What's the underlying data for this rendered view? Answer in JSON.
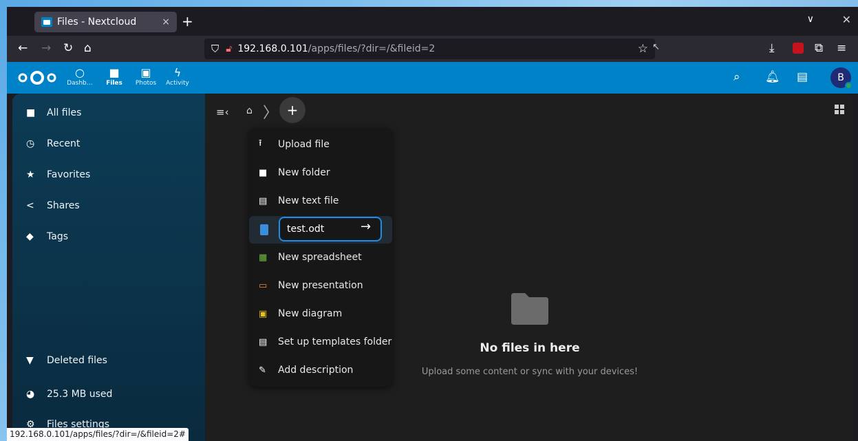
{
  "browser": {
    "tab_title": "Files - Nextcloud",
    "tab_close": "×",
    "new_tab": "+",
    "tab_list": "∨",
    "window_close": "✕",
    "url_host": "192.168.0.101",
    "url_path": "/apps/files/?dir=/&fileid=2",
    "status_url": "192.168.0.101/apps/files/?dir=/&fileid=2#"
  },
  "nc_header": {
    "apps": [
      {
        "label": "Dashb…",
        "icon": "dashboard-icon"
      },
      {
        "label": "Files",
        "icon": "folder-icon"
      },
      {
        "label": "Photos",
        "icon": "photos-icon"
      },
      {
        "label": "Activity",
        "icon": "activity-icon"
      }
    ],
    "avatar_initial": "B"
  },
  "sidebar": {
    "items": [
      {
        "label": "All files",
        "icon": "folder-icon"
      },
      {
        "label": "Recent",
        "icon": "clock-icon"
      },
      {
        "label": "Favorites",
        "icon": "star-icon"
      },
      {
        "label": "Shares",
        "icon": "share-icon"
      },
      {
        "label": "Tags",
        "icon": "tag-icon"
      }
    ],
    "bottom": [
      {
        "label": "Deleted files",
        "icon": "trash-icon"
      },
      {
        "label": "25.3 MB used",
        "icon": "pie-chart-icon"
      },
      {
        "label": "Files settings",
        "icon": "gear-icon"
      }
    ]
  },
  "new_menu": {
    "items": [
      {
        "label": "Upload file",
        "icon": "upload-icon"
      },
      {
        "label": "New folder",
        "icon": "folder-icon"
      },
      {
        "label": "New text file",
        "icon": "text-file-icon"
      }
    ],
    "input_value": "test.odt",
    "items_after": [
      {
        "label": "New spreadsheet",
        "icon": "spreadsheet-icon"
      },
      {
        "label": "New presentation",
        "icon": "presentation-icon"
      },
      {
        "label": "New diagram",
        "icon": "diagram-icon"
      },
      {
        "label": "Set up templates folder",
        "icon": "template-icon"
      },
      {
        "label": "Add description",
        "icon": "pencil-icon"
      }
    ]
  },
  "empty": {
    "title": "No files in here",
    "subtitle": "Upload some content or sync with your devices!"
  },
  "colors": {
    "header": "#0082c9",
    "accent": "#1c8de8"
  }
}
